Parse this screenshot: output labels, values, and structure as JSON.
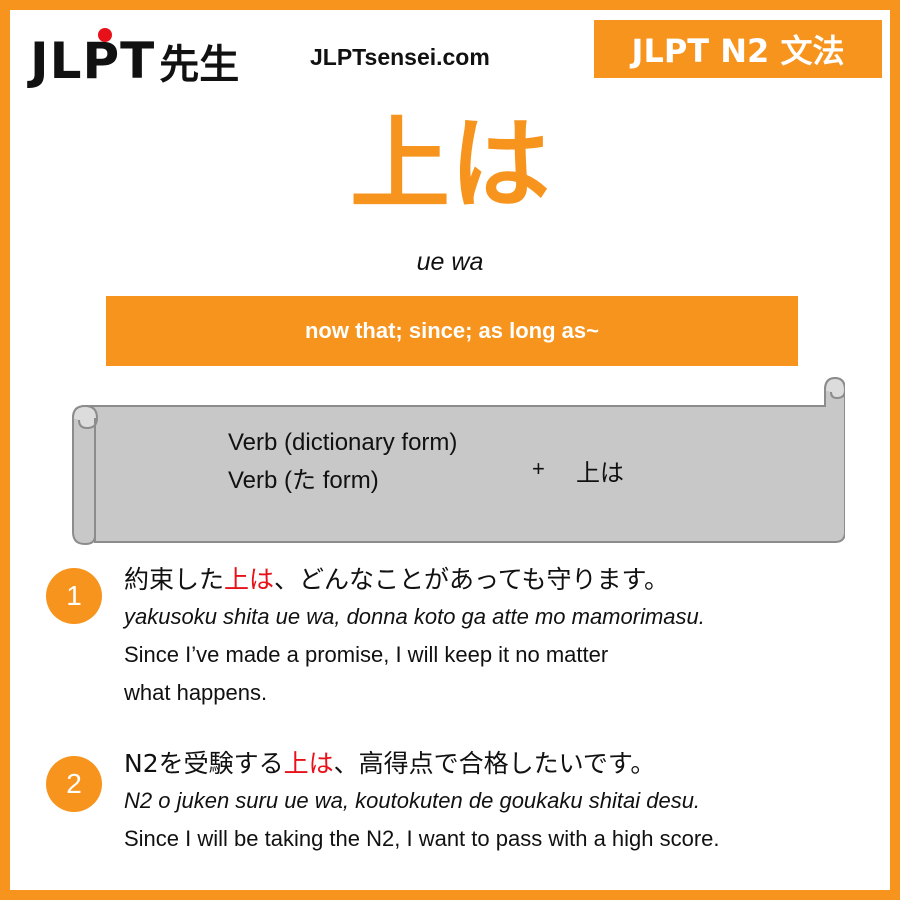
{
  "header": {
    "logo_text": "JLPT",
    "logo_sensei": "先生",
    "site": "JLPTsensei.com",
    "level_badge": "JLPT N2 文法"
  },
  "grammar": {
    "title": "上は",
    "romaji": "ue wa",
    "meaning": "now that; since; as long as~"
  },
  "formula": {
    "line1": "Verb (dictionary form)",
    "line2": "Verb (た form)",
    "plus": "+",
    "target": "上は"
  },
  "examples": [
    {
      "number": "1",
      "jp_before": "約束した",
      "jp_highlight": "上は",
      "jp_after": "、どんなことがあっても守ります。",
      "romaji": "yakusoku shita ue wa, donna koto ga atte mo mamorimasu.",
      "english_line1": "Since I’ve made a promise, I will keep it no matter",
      "english_line2": "what happens."
    },
    {
      "number": "2",
      "jp_before": "N2を受験する",
      "jp_highlight": "上は",
      "jp_after": "、高得点で合格したいです。",
      "romaji": "N2 o juken suru ue wa, koutokuten de goukaku shitai desu.",
      "english_line1": "Since I will be taking the N2, I want to pass with a high score."
    }
  ],
  "colors": {
    "accent": "#f7941d",
    "highlight": "#e8111a",
    "scroll_fill": "#c8c8c8",
    "scroll_stroke": "#8c8c8c"
  }
}
